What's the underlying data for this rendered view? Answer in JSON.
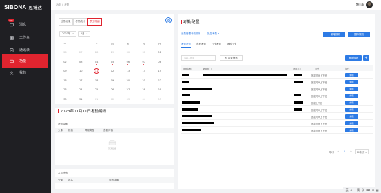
{
  "brand": {
    "logo_text": "SIBONA",
    "name_cn": "思博达"
  },
  "nav": {
    "items": [
      {
        "label": "消息",
        "badge": "99+",
        "icon": "message-icon"
      },
      {
        "label": "工作台",
        "icon": "workbench-icon"
      },
      {
        "label": "通讯录",
        "icon": "contacts-icon"
      },
      {
        "label": "功能",
        "icon": "function-icon"
      },
      {
        "label": "我的",
        "icon": "user-icon"
      }
    ]
  },
  "topbar": {
    "crumb_1": "功能",
    "crumb_2": "考勤",
    "user_name": "李佳清"
  },
  "left": {
    "tabs": [
      "出勤记录",
      "考勤统计",
      "员工明细"
    ],
    "year": "2023年",
    "month": "1月",
    "weekdays": [
      "一",
      "二",
      "三",
      "四",
      "五",
      "六",
      "日"
    ],
    "weeks": [
      [
        "26",
        "27",
        "28",
        "29",
        "30",
        "31",
        "01"
      ],
      [
        "02",
        "03",
        "04",
        "05",
        "06",
        "07",
        "08"
      ],
      [
        "09",
        "10",
        "11",
        "12",
        "13",
        "14",
        "15"
      ],
      [
        "16",
        "17",
        "18",
        "19",
        "20",
        "21",
        "22"
      ],
      [
        "23",
        "24",
        "25",
        "26",
        "27",
        "28",
        "29"
      ],
      [
        "30",
        "31",
        "01",
        "02",
        "03",
        "04",
        "05"
      ]
    ],
    "detail_title": "2023年01月11日考勤明细",
    "section1": "考勤异常",
    "cols1": [
      "头像",
      "姓名",
      "异常类型",
      "查看详情"
    ],
    "empty_text": "暂无数据",
    "section2": "人员外出",
    "cols2": [
      "头像",
      "姓名",
      "查看详情"
    ]
  },
  "right": {
    "title": "考勤配置",
    "link_1": "出勤管理考勤规则",
    "link_2": "批量考勤",
    "btn_new_rule": "+ 新增规则",
    "btn_delete_rule": "删除规则",
    "sub_tabs": [
      "考勤考勤",
      "出差考勤",
      "打卡考勤",
      "请假打卡"
    ],
    "search_placeholder": "请输入搜索",
    "reset_label": "重置筛选",
    "add_label": "添加规则",
    "plus_label": "+",
    "cols": [
      "规则名称",
      "使用部门",
      "适用员工",
      "类型",
      "操作"
    ],
    "rows": [
      {
        "type": "固定时间上下班",
        "op": "编辑"
      },
      {
        "type": "固定时间上下班",
        "op": "编辑"
      },
      {
        "type": "固定时间上下班",
        "op": "编辑"
      },
      {
        "type": "固定时间上下班",
        "op": "编辑"
      },
      {
        "type": "固定上下班",
        "op": "编辑"
      },
      {
        "type": "固定时间上下班",
        "op": "编辑"
      },
      {
        "type": "固定时间上下班",
        "op": "编辑"
      },
      {
        "type": "固定时间上下班",
        "op": "编辑"
      },
      {
        "type": "固定时间上下班",
        "op": "编辑"
      }
    ],
    "pager_total": "共9条",
    "pager_prev": "<",
    "pager_page": "1",
    "pager_next": ">",
    "pager_size": "10条/页"
  },
  "ime": {
    "items": [
      "英",
      "⊙",
      "·",
      "简",
      "☺",
      "⌨",
      "⚙",
      "▦"
    ]
  },
  "colors": {
    "accent": "#e0242f",
    "primary": "#2d7be5",
    "sidebar": "#1f1f23"
  }
}
